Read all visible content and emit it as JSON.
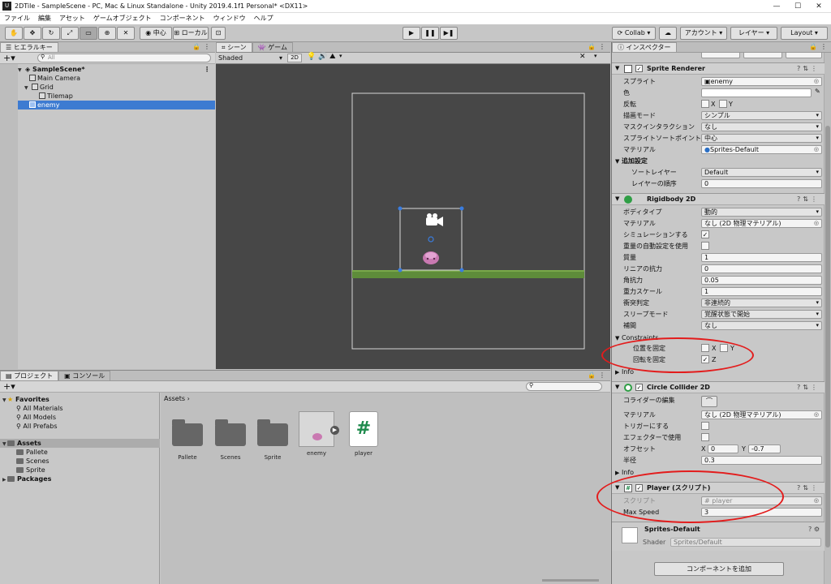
{
  "window": {
    "title": "2DTile - SampleScene - PC, Mac & Linux Standalone - Unity 2019.4.1f1 Personal* <DX11>",
    "logo_text": "U",
    "minimize": "—",
    "maximize": "☐",
    "close": "✕"
  },
  "menu": [
    "ファイル",
    "編集",
    "アセット",
    "ゲームオブジェクト",
    "コンポーネント",
    "ウィンドウ",
    "ヘルプ"
  ],
  "toolbar": {
    "pivot_label": "中心",
    "space_label": "ローカル",
    "collab_label": "Collab",
    "account_label": "アカウント",
    "layers_label": "レイヤー",
    "layout_label": "Layout"
  },
  "hierarchy": {
    "tab": "ヒエラルキー",
    "search_placeholder": "All",
    "items": [
      {
        "label": "SampleScene*",
        "level": 0
      },
      {
        "label": "Main Camera",
        "level": 1
      },
      {
        "label": "Grid",
        "level": 1
      },
      {
        "label": "Tilemap",
        "level": 2
      },
      {
        "label": "enemy",
        "level": 1
      }
    ]
  },
  "scene": {
    "tab_scene": "シーン",
    "tab_game": "ゲーム",
    "shading": "Shaded",
    "mode_2d": "2D"
  },
  "project": {
    "tab_project": "プロジェクト",
    "tab_console": "コンソール",
    "breadcrumb": "Assets",
    "tree": [
      {
        "label": "Favorites",
        "level": 0
      },
      {
        "label": "All Materials",
        "level": 1
      },
      {
        "label": "All Models",
        "level": 1
      },
      {
        "label": "All Prefabs",
        "level": 1
      },
      {
        "label": "Assets",
        "level": 0
      },
      {
        "label": "Pallete",
        "level": 1
      },
      {
        "label": "Scenes",
        "level": 1
      },
      {
        "label": "Sprite",
        "level": 1
      },
      {
        "label": "Packages",
        "level": 0
      }
    ],
    "assets": [
      "Pallete",
      "Scenes",
      "Sprite",
      "enemy",
      "player"
    ]
  },
  "inspector": {
    "tab": "インスペクター",
    "sprite_renderer": {
      "title": "Sprite Renderer",
      "sprite_label": "スプライト",
      "sprite_value": "enemy",
      "color_label": "色",
      "flip_label": "反転",
      "flip_x": "X",
      "flip_y": "Y",
      "draw_mode_label": "描画モード",
      "draw_mode_value": "シンプル",
      "mask_label": "マスクインタラクション",
      "mask_value": "なし",
      "sort_point_label": "スプライトソートポイント",
      "sort_point_value": "中心",
      "material_label": "マテリアル",
      "material_value": "Sprites-Default",
      "additional_label": "追加設定",
      "sorting_layer_label": "ソートレイヤー",
      "sorting_layer_value": "Default",
      "order_label": "レイヤーの順序",
      "order_value": "0"
    },
    "rigidbody": {
      "title": "Rigidbody 2D",
      "body_type_label": "ボディタイプ",
      "body_type_value": "動的",
      "material_label": "マテリアル",
      "material_value": "なし (2D 物理マテリアル)",
      "simulated_label": "シミュレーションする",
      "auto_mass_label": "重量の自動設定を使用",
      "mass_label": "質量",
      "mass_value": "1",
      "linear_drag_label": "リニアの抗力",
      "linear_drag_value": "0",
      "angular_drag_label": "角抗力",
      "angular_drag_value": "0.05",
      "gravity_label": "重力スケール",
      "gravity_value": "1",
      "collision_label": "衝突判定",
      "collision_value": "非連続的",
      "sleep_label": "スリープモード",
      "sleep_value": "覚醒状態で開始",
      "interp_label": "補間",
      "interp_value": "なし",
      "constraints_label": "Constraints",
      "freeze_pos_label": "位置を固定",
      "freeze_pos_x": "X",
      "freeze_pos_y": "Y",
      "freeze_rot_label": "回転を固定",
      "freeze_rot_z": "Z",
      "info_label": "Info"
    },
    "circle": {
      "title": "Circle Collider 2D",
      "edit_label": "コライダーの編集",
      "material_label": "マテリアル",
      "material_value": "なし (2D 物理マテリアル)",
      "trigger_label": "トリガーにする",
      "effector_label": "エフェクターで使用",
      "offset_label": "オフセット",
      "offset_x_label": "X",
      "offset_x": "0",
      "offset_y_label": "Y",
      "offset_y": "-0.7",
      "radius_label": "半径",
      "radius_value": "0.3",
      "info_label": "Info"
    },
    "player": {
      "title": "Player (スクリプト)",
      "script_label": "スクリプト",
      "script_value": "player",
      "speed_label": "Max Speed",
      "speed_value": "3"
    },
    "material": {
      "name": "Sprites-Default",
      "shader_label": "Shader",
      "shader_value": "Sprites/Default"
    },
    "add_component": "コンポーネントを追加"
  }
}
